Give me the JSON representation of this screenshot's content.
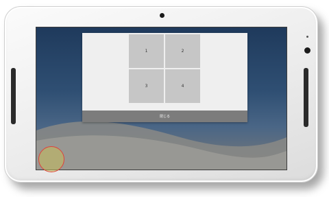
{
  "device": {
    "type": "tablet"
  },
  "dialog": {
    "tiles": [
      {
        "label": "1"
      },
      {
        "label": "2"
      },
      {
        "label": "3"
      },
      {
        "label": "4"
      }
    ],
    "close_label": "閉じる"
  },
  "colors": {
    "screen_background": "#2f4f73",
    "tile": "#c6c6c6",
    "footer": "#7c7c7c",
    "touch_ring": "#e0413a"
  },
  "icons": {
    "touch_indicator": "touch-point-icon"
  }
}
